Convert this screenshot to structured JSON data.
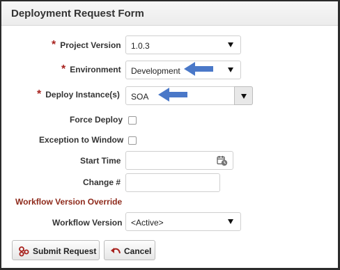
{
  "form": {
    "title": "Deployment Request Form"
  },
  "fields": {
    "required_marker": "*",
    "project_version": {
      "label": "Project Version",
      "value": "1.0.3"
    },
    "environment": {
      "label": "Environment",
      "value": "Development"
    },
    "deploy_instances": {
      "label": "Deploy Instance(s)",
      "value": "SOA"
    },
    "force_deploy": {
      "label": "Force Deploy",
      "checked": false
    },
    "exception_to_window": {
      "label": "Exception to Window",
      "checked": false
    },
    "start_time": {
      "label": "Start Time",
      "value": ""
    },
    "change_number": {
      "label": "Change #",
      "value": ""
    },
    "workflow_override_heading": "Workflow Version Override",
    "workflow_version": {
      "label": "Workflow Version",
      "value": "<Active>"
    }
  },
  "actions": {
    "submit_label": "Submit Request",
    "cancel_label": "Cancel"
  },
  "colors": {
    "required": "#a8221e",
    "section_heading": "#8e2a1b",
    "annotation_arrow": "#4a78c8"
  },
  "icons": [
    "caret-down-icon",
    "calendar-clock-icon",
    "submit-workflow-icon",
    "cancel-undo-icon",
    "annotation-arrow-icon"
  ]
}
